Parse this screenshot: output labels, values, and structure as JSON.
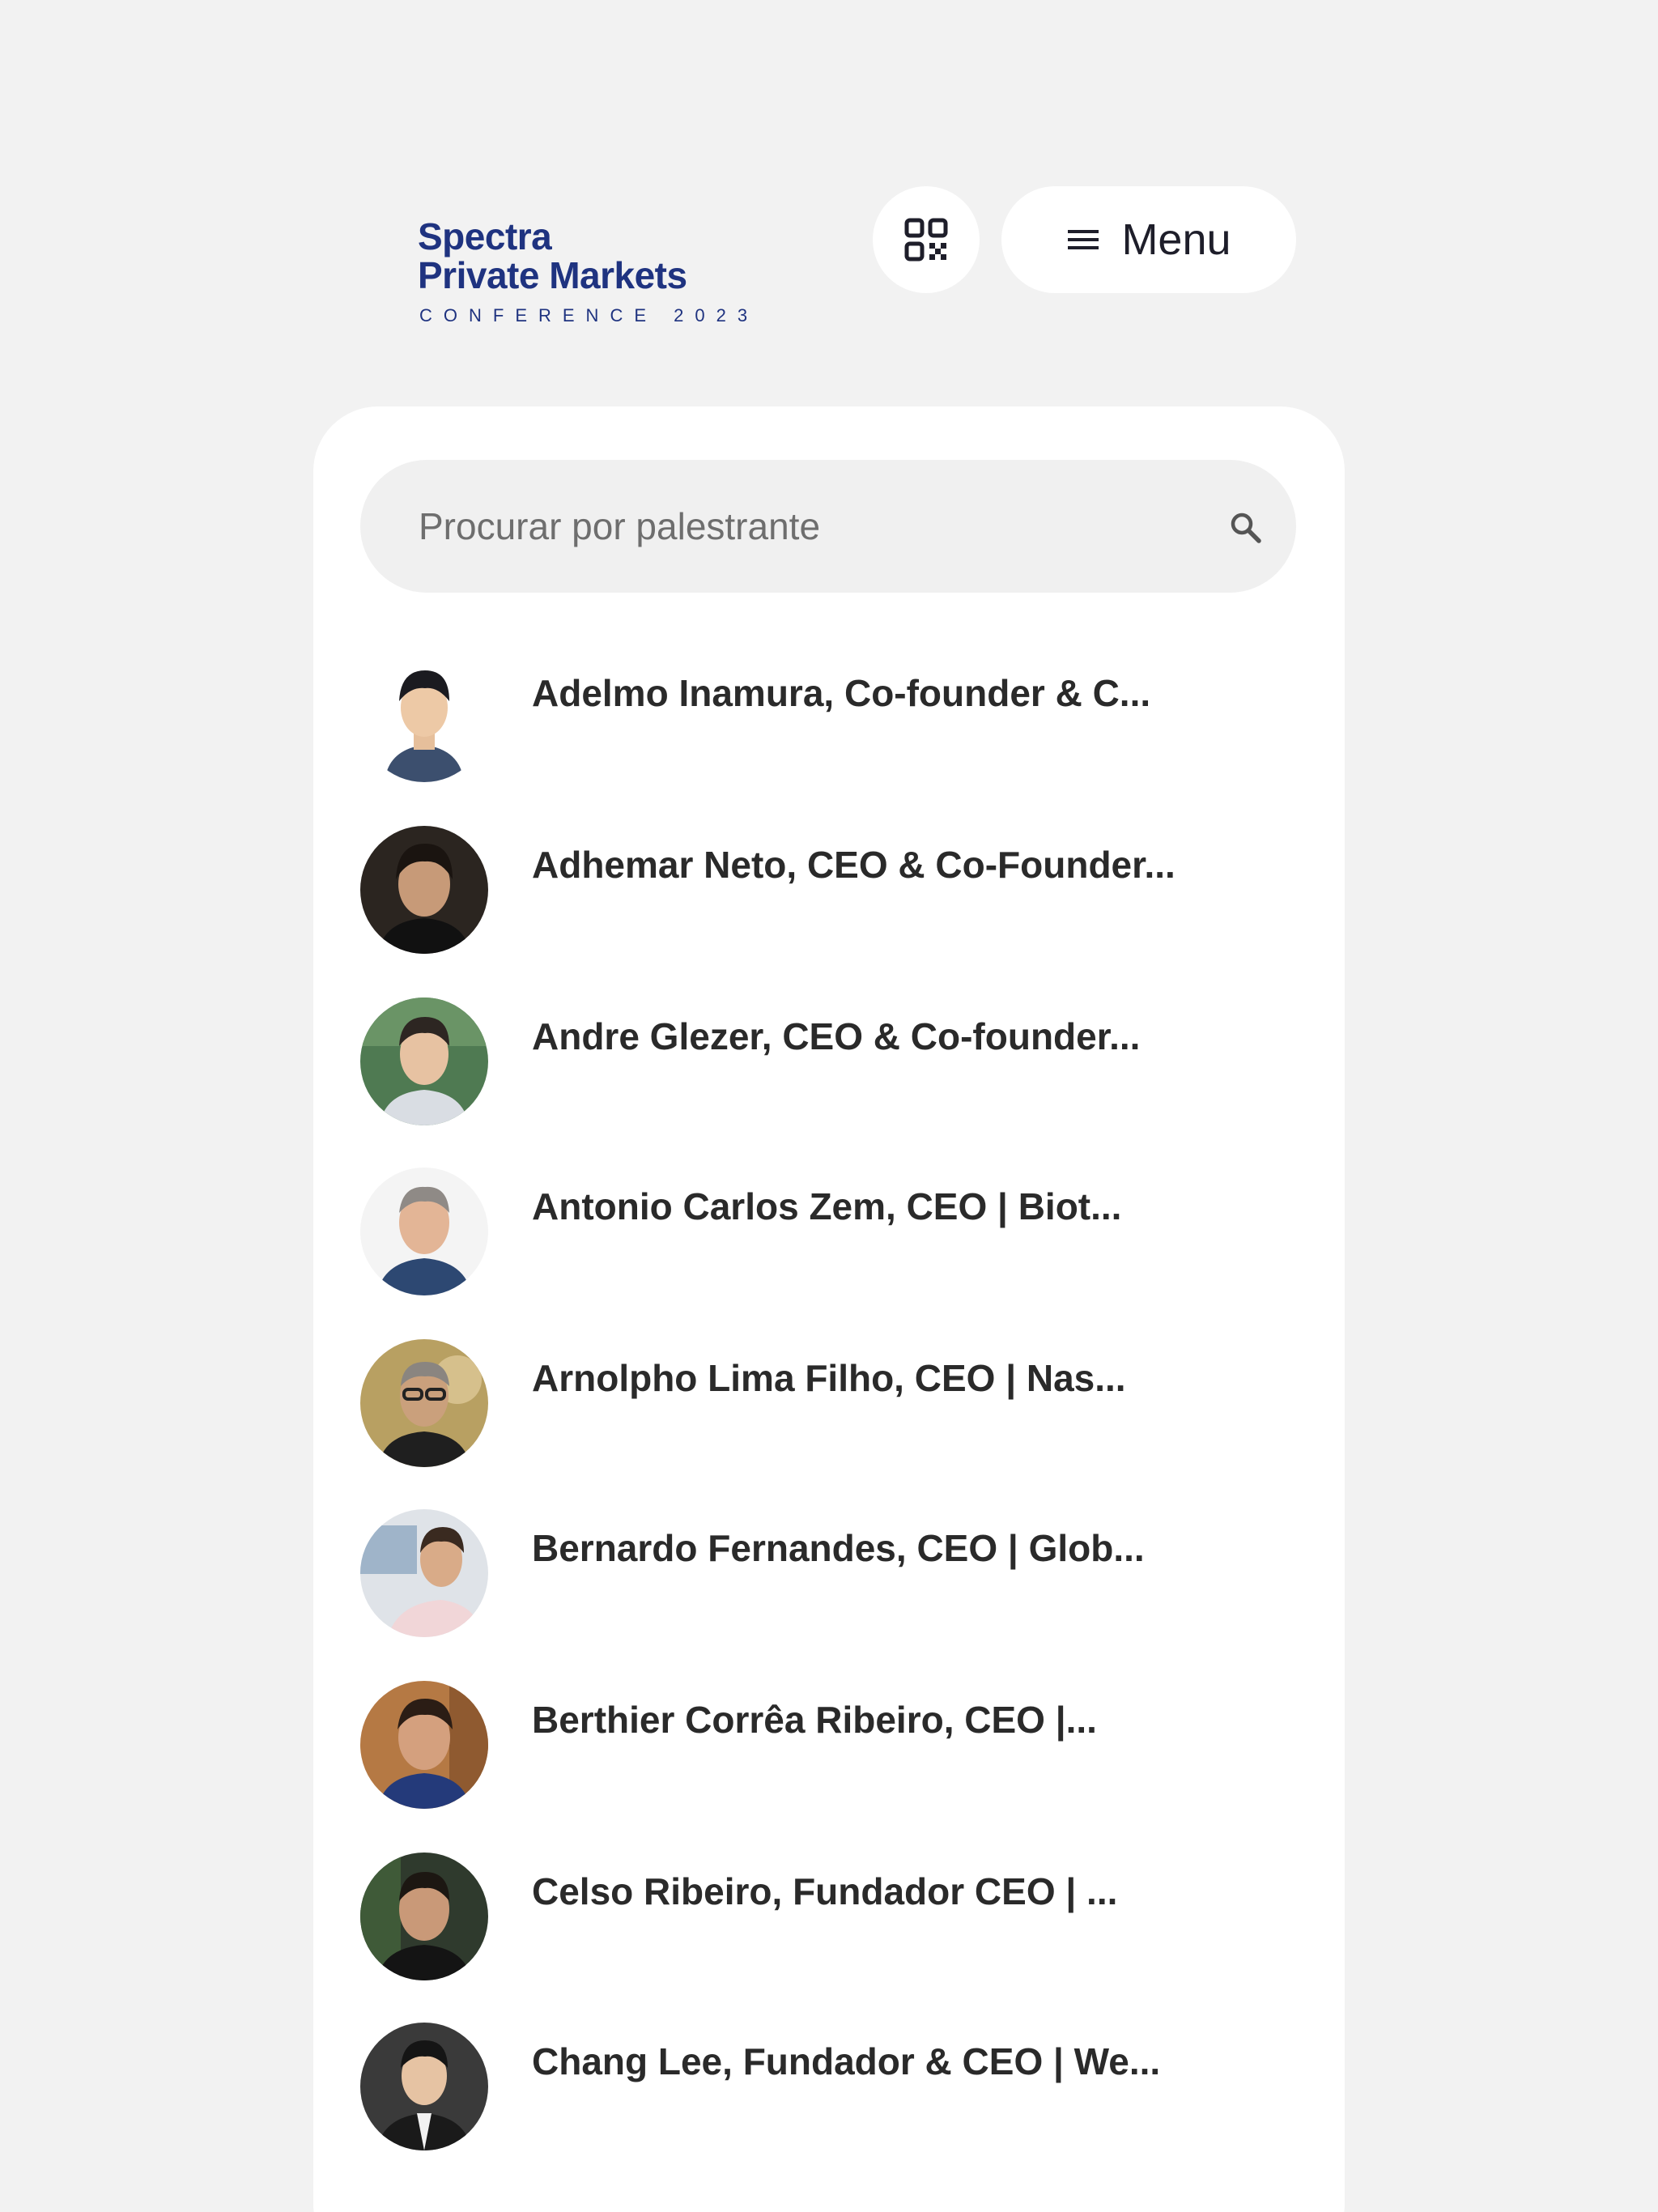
{
  "header": {
    "logo": {
      "line1": "Spectra",
      "line2": "Private Markets",
      "line3": "CONFERENCE 2023",
      "color": "#1f3380"
    },
    "qr_button": {
      "icon": "qr-code-icon"
    },
    "menu_button": {
      "icon": "hamburger-menu-icon",
      "label": "Menu"
    }
  },
  "search": {
    "placeholder": "Procurar por palestrante",
    "value": "",
    "icon": "search-icon"
  },
  "speakers": [
    {
      "name": "Adelmo Inamura, Co-founder & C..."
    },
    {
      "name": "Adhemar Neto, CEO & Co-Founder..."
    },
    {
      "name": "Andre Glezer, CEO & Co-founder..."
    },
    {
      "name": "Antonio Carlos Zem, CEO | Biot..."
    },
    {
      "name": "Arnolpho Lima Filho, CEO | Nas..."
    },
    {
      "name": "Bernardo Fernandes, CEO | Glob..."
    },
    {
      "name": "Berthier Corrêa Ribeiro, CEO |..."
    },
    {
      "name": "Celso Ribeiro, Fundador CEO | ..."
    },
    {
      "name": "Chang Lee, Fundador & CEO | We..."
    }
  ],
  "colors": {
    "background": "#f2f2f2",
    "card": "#ffffff",
    "search_bg": "#f0f0f0",
    "text": "#2a2a2a",
    "brand": "#1f3380"
  }
}
